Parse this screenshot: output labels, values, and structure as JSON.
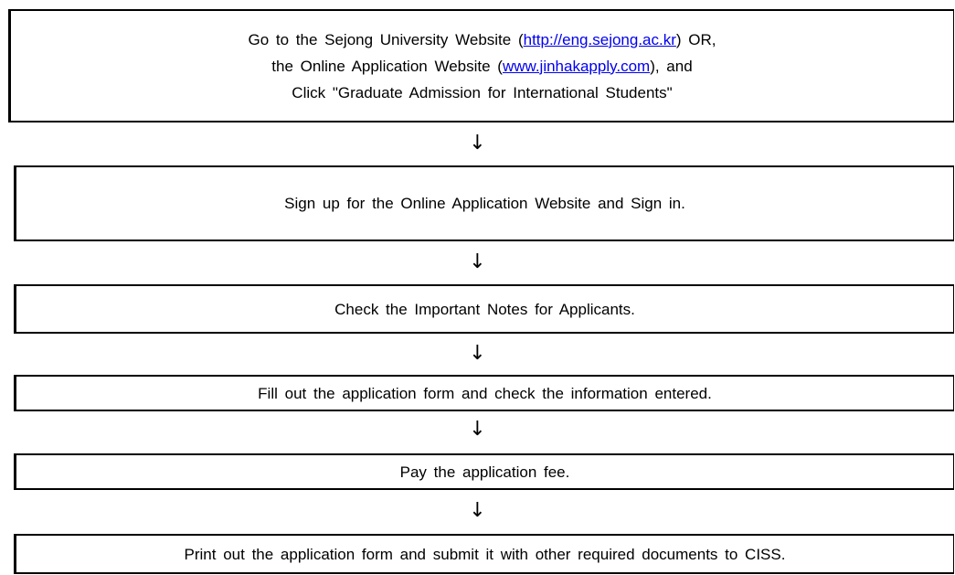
{
  "steps": [
    {
      "lines": [
        {
          "pre": "Go to the Sejong University Website (",
          "link": "http://eng.sejong.ac.kr",
          "post": ") OR,"
        },
        {
          "pre": "the Online Application Website (",
          "link": "www.jinhakapply.com",
          "post": "), and"
        },
        {
          "text": "Click \"Graduate Admission for International Students\""
        }
      ]
    },
    {
      "text": "Sign up for the Online Application Website and Sign in."
    },
    {
      "text": "Check the Important Notes for Applicants."
    },
    {
      "text": "Fill out the application form and check the information entered."
    },
    {
      "text": "Pay the application fee."
    },
    {
      "text": "Print out the application form and submit it with other required documents to CISS."
    }
  ],
  "arrow_glyph": "↓"
}
